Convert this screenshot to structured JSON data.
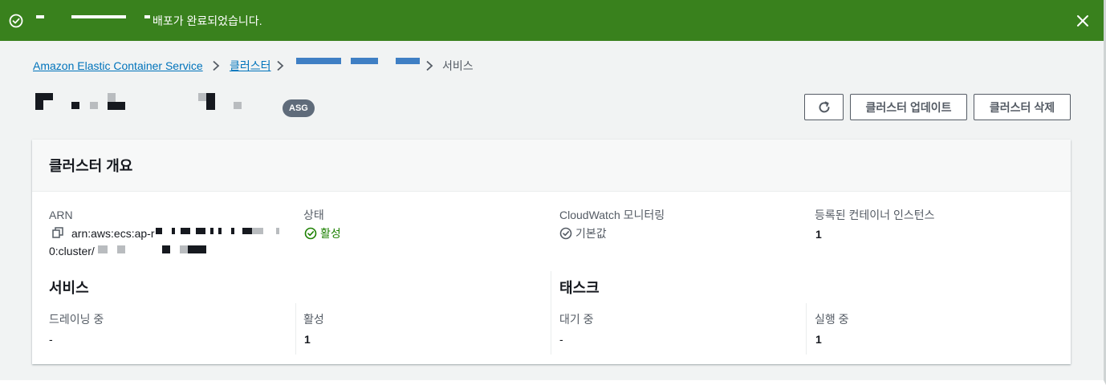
{
  "flash": {
    "message": "배포가 완료되었습니다.",
    "status_icon": "check-circle-icon",
    "close_icon": "close-icon",
    "color": "#39811d"
  },
  "breadcrumb": {
    "items": [
      {
        "label": "Amazon Elastic Container Service"
      },
      {
        "label": "클러스터"
      }
    ],
    "current": "서비스"
  },
  "header": {
    "badge": "ASG",
    "buttons": {
      "refresh_icon": "refresh-icon",
      "update": "클러스터 업데이트",
      "delete": "클러스터 삭제"
    }
  },
  "overview": {
    "title": "클러스터 개요",
    "arn": {
      "label": "ARN",
      "line1": "arn:aws:ecs:ap-r",
      "line2": "0:cluster/",
      "copy_icon": "copy-icon"
    },
    "status": {
      "label": "상태",
      "value": "활성",
      "icon": "check-circle-icon"
    },
    "cloudwatch": {
      "label": "CloudWatch 모니터링",
      "value": "기본값",
      "icon": "check-circle-icon"
    },
    "instances": {
      "label": "등록된 컨테이너 인스턴스",
      "value": "1"
    },
    "services": {
      "heading": "서비스",
      "draining": {
        "label": "드레이닝 중",
        "value": "-"
      },
      "active": {
        "label": "활성",
        "value": "1"
      }
    },
    "tasks": {
      "heading": "태스크",
      "pending": {
        "label": "대기 중",
        "value": "-"
      },
      "running": {
        "label": "실행 중",
        "value": "1"
      }
    }
  }
}
